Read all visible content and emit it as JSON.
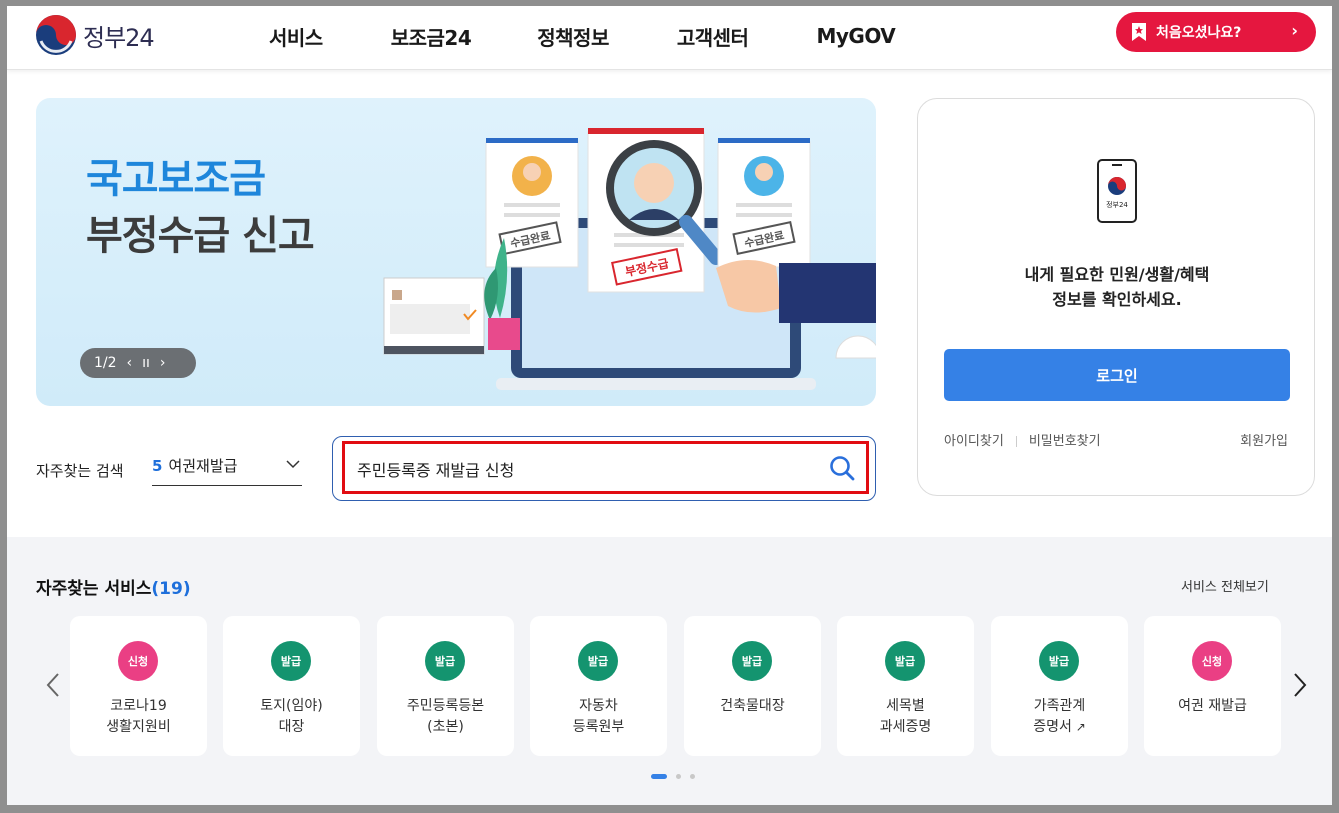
{
  "header": {
    "logo_text": "정부24",
    "nav": [
      "서비스",
      "보조금24",
      "정책정보",
      "고객센터",
      "MyGOV"
    ],
    "first_visit_label": "처음오셨나요?",
    "first_visit_arrow": "›"
  },
  "banner": {
    "title_line1": "국고보조금",
    "title_line2": "부정수급 신고",
    "stamp_received": "수급완료",
    "stamp_fraud": "부정수급",
    "pager": {
      "current": "1/2",
      "prev": "‹",
      "pause": "ıı",
      "next": "›"
    },
    "colors": {
      "title_accent": "#1e86db",
      "background": "#d8effb"
    }
  },
  "search": {
    "frequent_label": "자주찾는 검색",
    "frequent_rank": "5",
    "frequent_value": "여권재발급",
    "query": "주민등록증 재발급 신청"
  },
  "login": {
    "phone_label": "정부24",
    "message_line1": "내게 필요한 민원/생활/혜택",
    "message_line2": "정보를 확인하세요.",
    "login_button": "로그인",
    "find_id": "아이디찾기",
    "find_password": "비밀번호찾기",
    "signup": "회원가입",
    "button_color": "#3581e6"
  },
  "services": {
    "title": "자주찾는 서비스",
    "count": "(19)",
    "view_all": "서비스 전체보기",
    "items": [
      {
        "badge": "신청",
        "badge_color": "#ea3f84",
        "line1": "코로나19",
        "line2": "생활지원비"
      },
      {
        "badge": "발급",
        "badge_color": "#14946f",
        "line1": "토지(임야)",
        "line2": "대장"
      },
      {
        "badge": "발급",
        "badge_color": "#14946f",
        "line1": "주민등록등본",
        "line2": "(초본)"
      },
      {
        "badge": "발급",
        "badge_color": "#14946f",
        "line1": "자동차",
        "line2": "등록원부"
      },
      {
        "badge": "발급",
        "badge_color": "#14946f",
        "line1": "건축물대장",
        "line2": ""
      },
      {
        "badge": "발급",
        "badge_color": "#14946f",
        "line1": "세목별",
        "line2": "과세증명"
      },
      {
        "badge": "발급",
        "badge_color": "#14946f",
        "line1": "가족관계",
        "line2": "증명서"
      },
      {
        "badge": "신청",
        "badge_color": "#ea3f84",
        "line1": "여권 재발급",
        "line2": ""
      }
    ],
    "pagination_pages": 3,
    "pagination_active": 1
  }
}
